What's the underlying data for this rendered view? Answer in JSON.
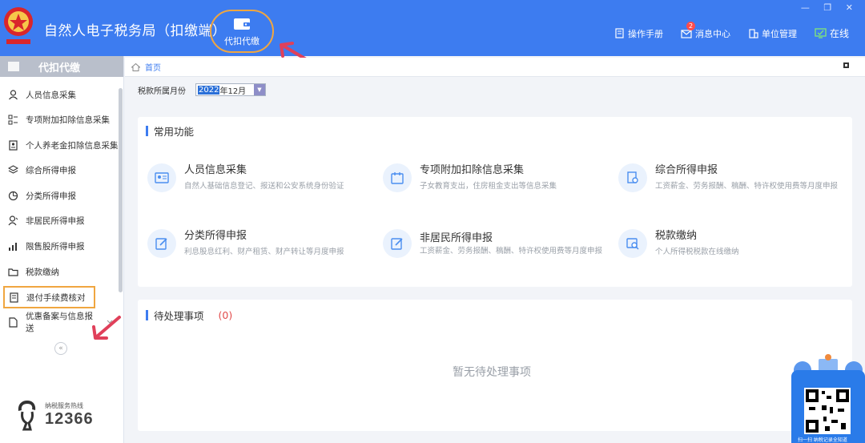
{
  "header": {
    "title": "自然人电子税务局（扣缴端）",
    "module_label": "代扣代缴",
    "window_controls": "— ❐ ✕",
    "tools": [
      {
        "label": "操作手册",
        "icon": "manual-icon"
      },
      {
        "label": "消息中心",
        "icon": "message-icon",
        "badge": "2"
      },
      {
        "label": "单位管理",
        "icon": "building-icon"
      }
    ],
    "status": "在线"
  },
  "sidebar": {
    "title": "代扣代缴",
    "items": [
      {
        "label": "人员信息采集",
        "icon": "person-icon"
      },
      {
        "label": "专项附加扣除信息采集",
        "icon": "grid-list-icon"
      },
      {
        "label": "个人养老金扣除信息采集",
        "icon": "pension-card-icon"
      },
      {
        "label": "综合所得申报",
        "icon": "layers-icon"
      },
      {
        "label": "分类所得申报",
        "icon": "pie-icon"
      },
      {
        "label": "非居民所得申报",
        "icon": "nonresident-icon"
      },
      {
        "label": "限售股所得申报",
        "icon": "bar-chart-icon"
      },
      {
        "label": "税款缴纳",
        "icon": "folder-icon"
      },
      {
        "label": "退付手续费核对",
        "icon": "refund-doc-icon"
      },
      {
        "label": "优惠备案与信息报送",
        "icon": "document-icon"
      }
    ],
    "collapse_label": "«",
    "hotline_caption": "纳税服务热线",
    "hotline_number": "12366"
  },
  "main": {
    "breadcrumb": "首页",
    "period_label": "税款所属月份",
    "period_year": "2022",
    "period_month": "年12月",
    "common_title": "常用功能",
    "functions": [
      {
        "name": "人员信息采集",
        "desc": "自然人基础信息登记、报送和公安系统身份验证",
        "icon": "id-card-icon"
      },
      {
        "name": "专项附加扣除信息采集",
        "desc": "子女教育支出，住房租金支出等信息采集",
        "icon": "calendar-icon"
      },
      {
        "name": "综合所得申报",
        "desc": "工资薪金、劳务报酬、稿酬、特许权使用费等月度申报",
        "icon": "doc-settings-icon"
      },
      {
        "name": "分类所得申报",
        "desc": "利息股息红利、财产租赁、财产转让等月度申报",
        "icon": "edit-icon"
      },
      {
        "name": "非居民所得申报",
        "desc": "工资薪金、劳务报酬、稿酬、特许权使用费等月度申报",
        "icon": "edit-icon"
      },
      {
        "name": "税款缴纳",
        "desc": "个人所得税税款在线缴纳",
        "icon": "tax-search-icon"
      }
    ],
    "pending_title": "待处理事项",
    "pending_count": "(0)",
    "pending_empty": "暂无待处理事项"
  },
  "widget": {
    "caption": "扫一扫 纳税记录全知道"
  },
  "colors": {
    "header_blue": "#3d7cf0",
    "annotation_orange": "#f0a640",
    "annotation_red": "#e0405a"
  }
}
